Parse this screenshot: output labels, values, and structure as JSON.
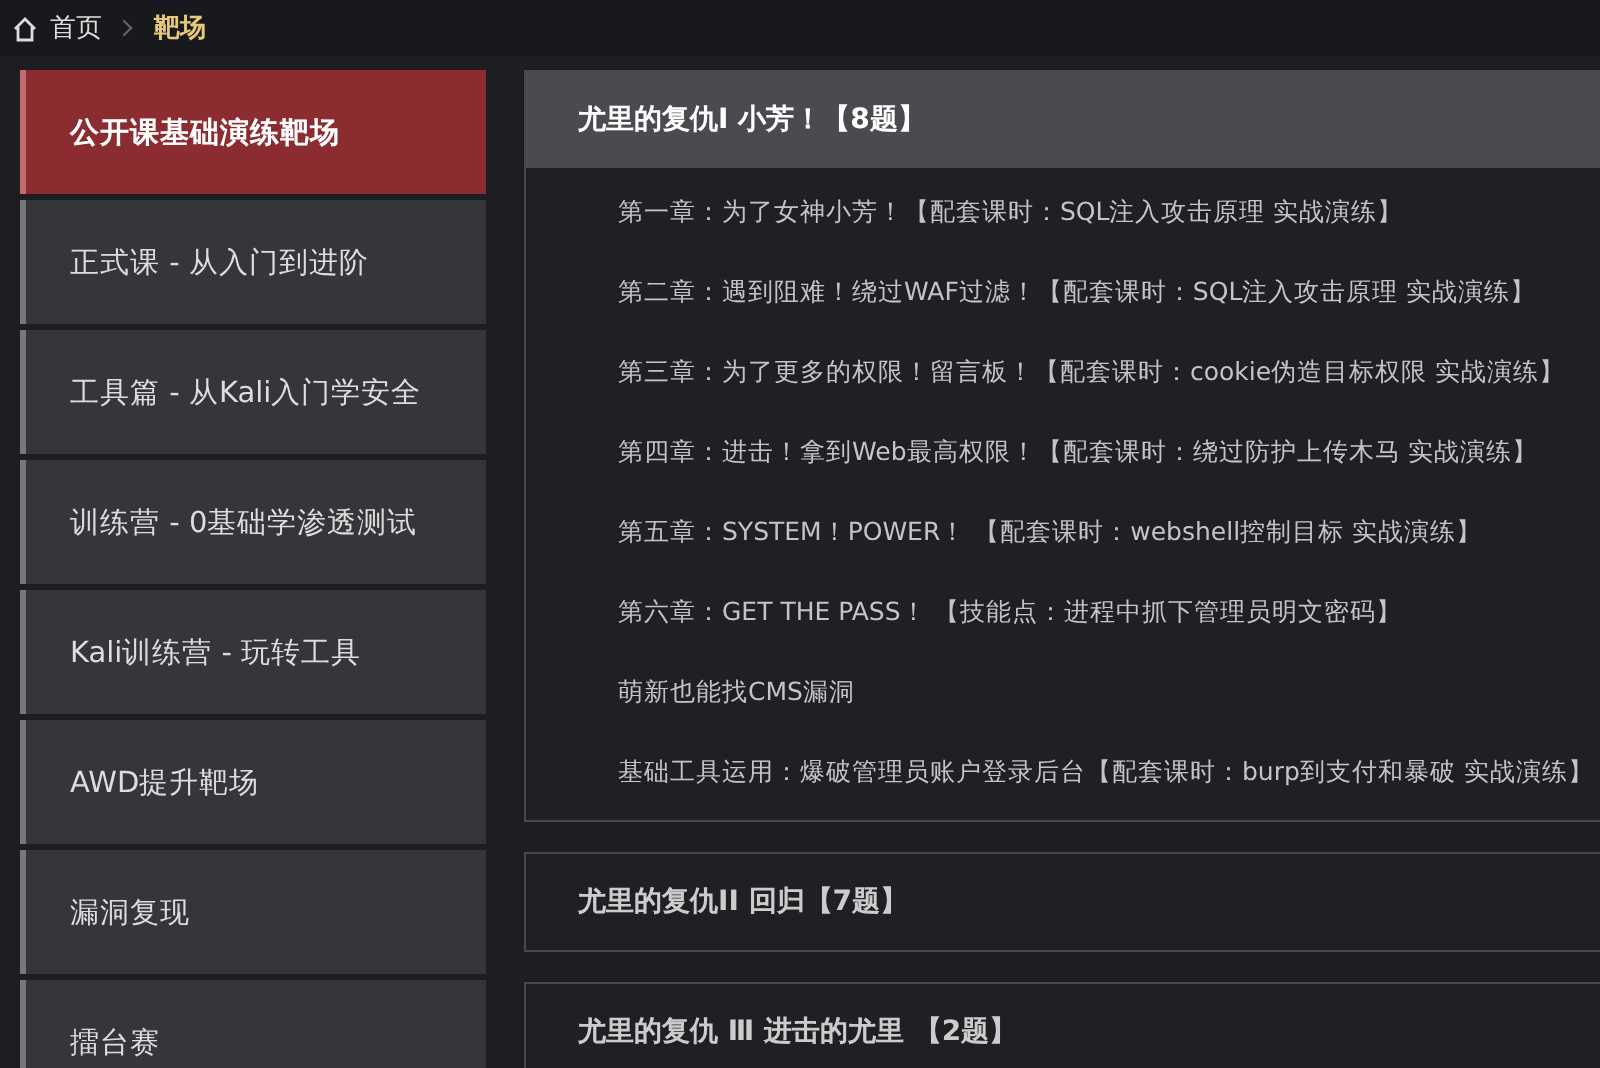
{
  "breadcrumb": {
    "items": [
      {
        "label": "首页",
        "selected": false
      },
      {
        "label": "靶场",
        "selected": true
      }
    ]
  },
  "sidebar": {
    "items": [
      {
        "label": "公开课基础演练靶场",
        "selected": true
      },
      {
        "label": "正式课 - 从入门到进阶",
        "selected": false
      },
      {
        "label": "工具篇 - 从Kali入门学安全",
        "selected": false
      },
      {
        "label": "训练营 - 0基础学渗透测试",
        "selected": false
      },
      {
        "label": "Kali训练营 - 玩转工具",
        "selected": false
      },
      {
        "label": "AWD提升靶场",
        "selected": false
      },
      {
        "label": "漏洞复现",
        "selected": false
      },
      {
        "label": "擂台赛",
        "selected": false
      }
    ]
  },
  "sections": [
    {
      "title": "尤里的复仇Ⅰ 小芳！【8题】",
      "expanded": true,
      "items": [
        "第一章：为了女神小芳！【配套课时：SQL注入攻击原理 实战演练】",
        "第二章：遇到阻难！绕过WAF过滤！【配套课时：SQL注入攻击原理 实战演练】",
        "第三章：为了更多的权限！留言板！【配套课时：cookie伪造目标权限 实战演练】",
        "第四章：进击！拿到Web最高权限！【配套课时：绕过防护上传木马 实战演练】",
        "第五章：SYSTEM！POWER！ 【配套课时：webshell控制目标 实战演练】",
        "第六章：GET THE PASS！ 【技能点：进程中抓下管理员明文密码】",
        "萌新也能找CMS漏洞",
        "基础工具运用：爆破管理员账户登录后台【配套课时：burp到支付和暴破 实战演练】"
      ]
    },
    {
      "title": "尤里的复仇II 回归【7题】",
      "expanded": false
    },
    {
      "title": "尤里的复仇 Ⅲ 进击的尤里 【2题】",
      "expanded": false
    }
  ]
}
